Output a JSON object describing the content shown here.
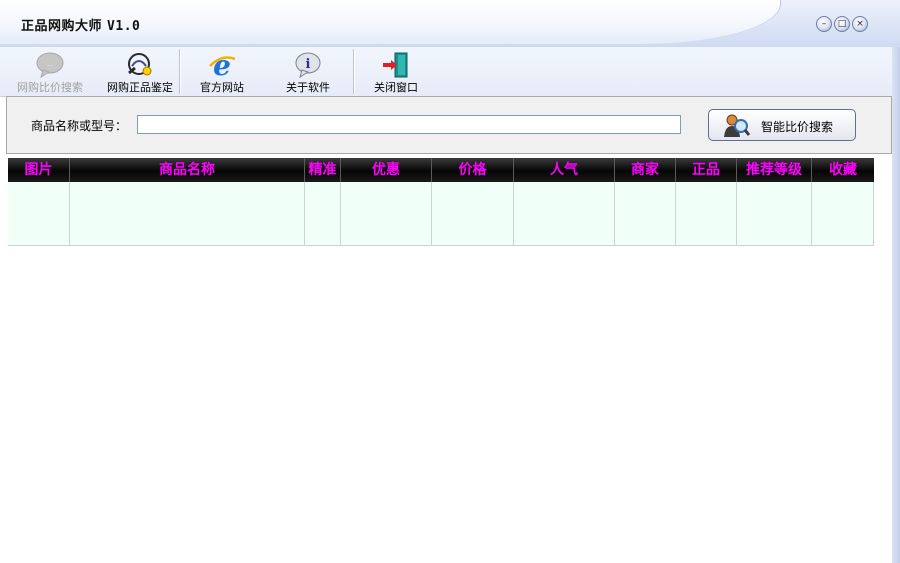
{
  "window": {
    "title": "正品网购大师",
    "version": "V1.0"
  },
  "window_controls": {
    "minimize": "–",
    "maximize": "□",
    "close": "×"
  },
  "toolbar": {
    "items": [
      {
        "label": "网购比价搜索",
        "icon": "chat-bubble-icon",
        "disabled": true
      },
      {
        "label": "网购正品鉴定",
        "icon": "magnifier-badge-icon",
        "disabled": false
      },
      {
        "label": "官方网站",
        "icon": "internet-explorer-icon",
        "disabled": false
      },
      {
        "label": "关于软件",
        "icon": "info-icon",
        "disabled": false
      },
      {
        "label": "关闭窗口",
        "icon": "exit-door-icon",
        "disabled": false
      }
    ]
  },
  "search": {
    "label": "商品名称或型号：",
    "value": "",
    "button_label": "智能比价搜索"
  },
  "table": {
    "columns": [
      "图片",
      "商品名称",
      "精准",
      "优惠",
      "价格",
      "人气",
      "商家",
      "正品",
      "推荐等级",
      "收藏"
    ],
    "rows": []
  },
  "colors": {
    "header_text": "#ff00ff",
    "header_bg": "#000000",
    "row_bg": "#f0fff8"
  }
}
